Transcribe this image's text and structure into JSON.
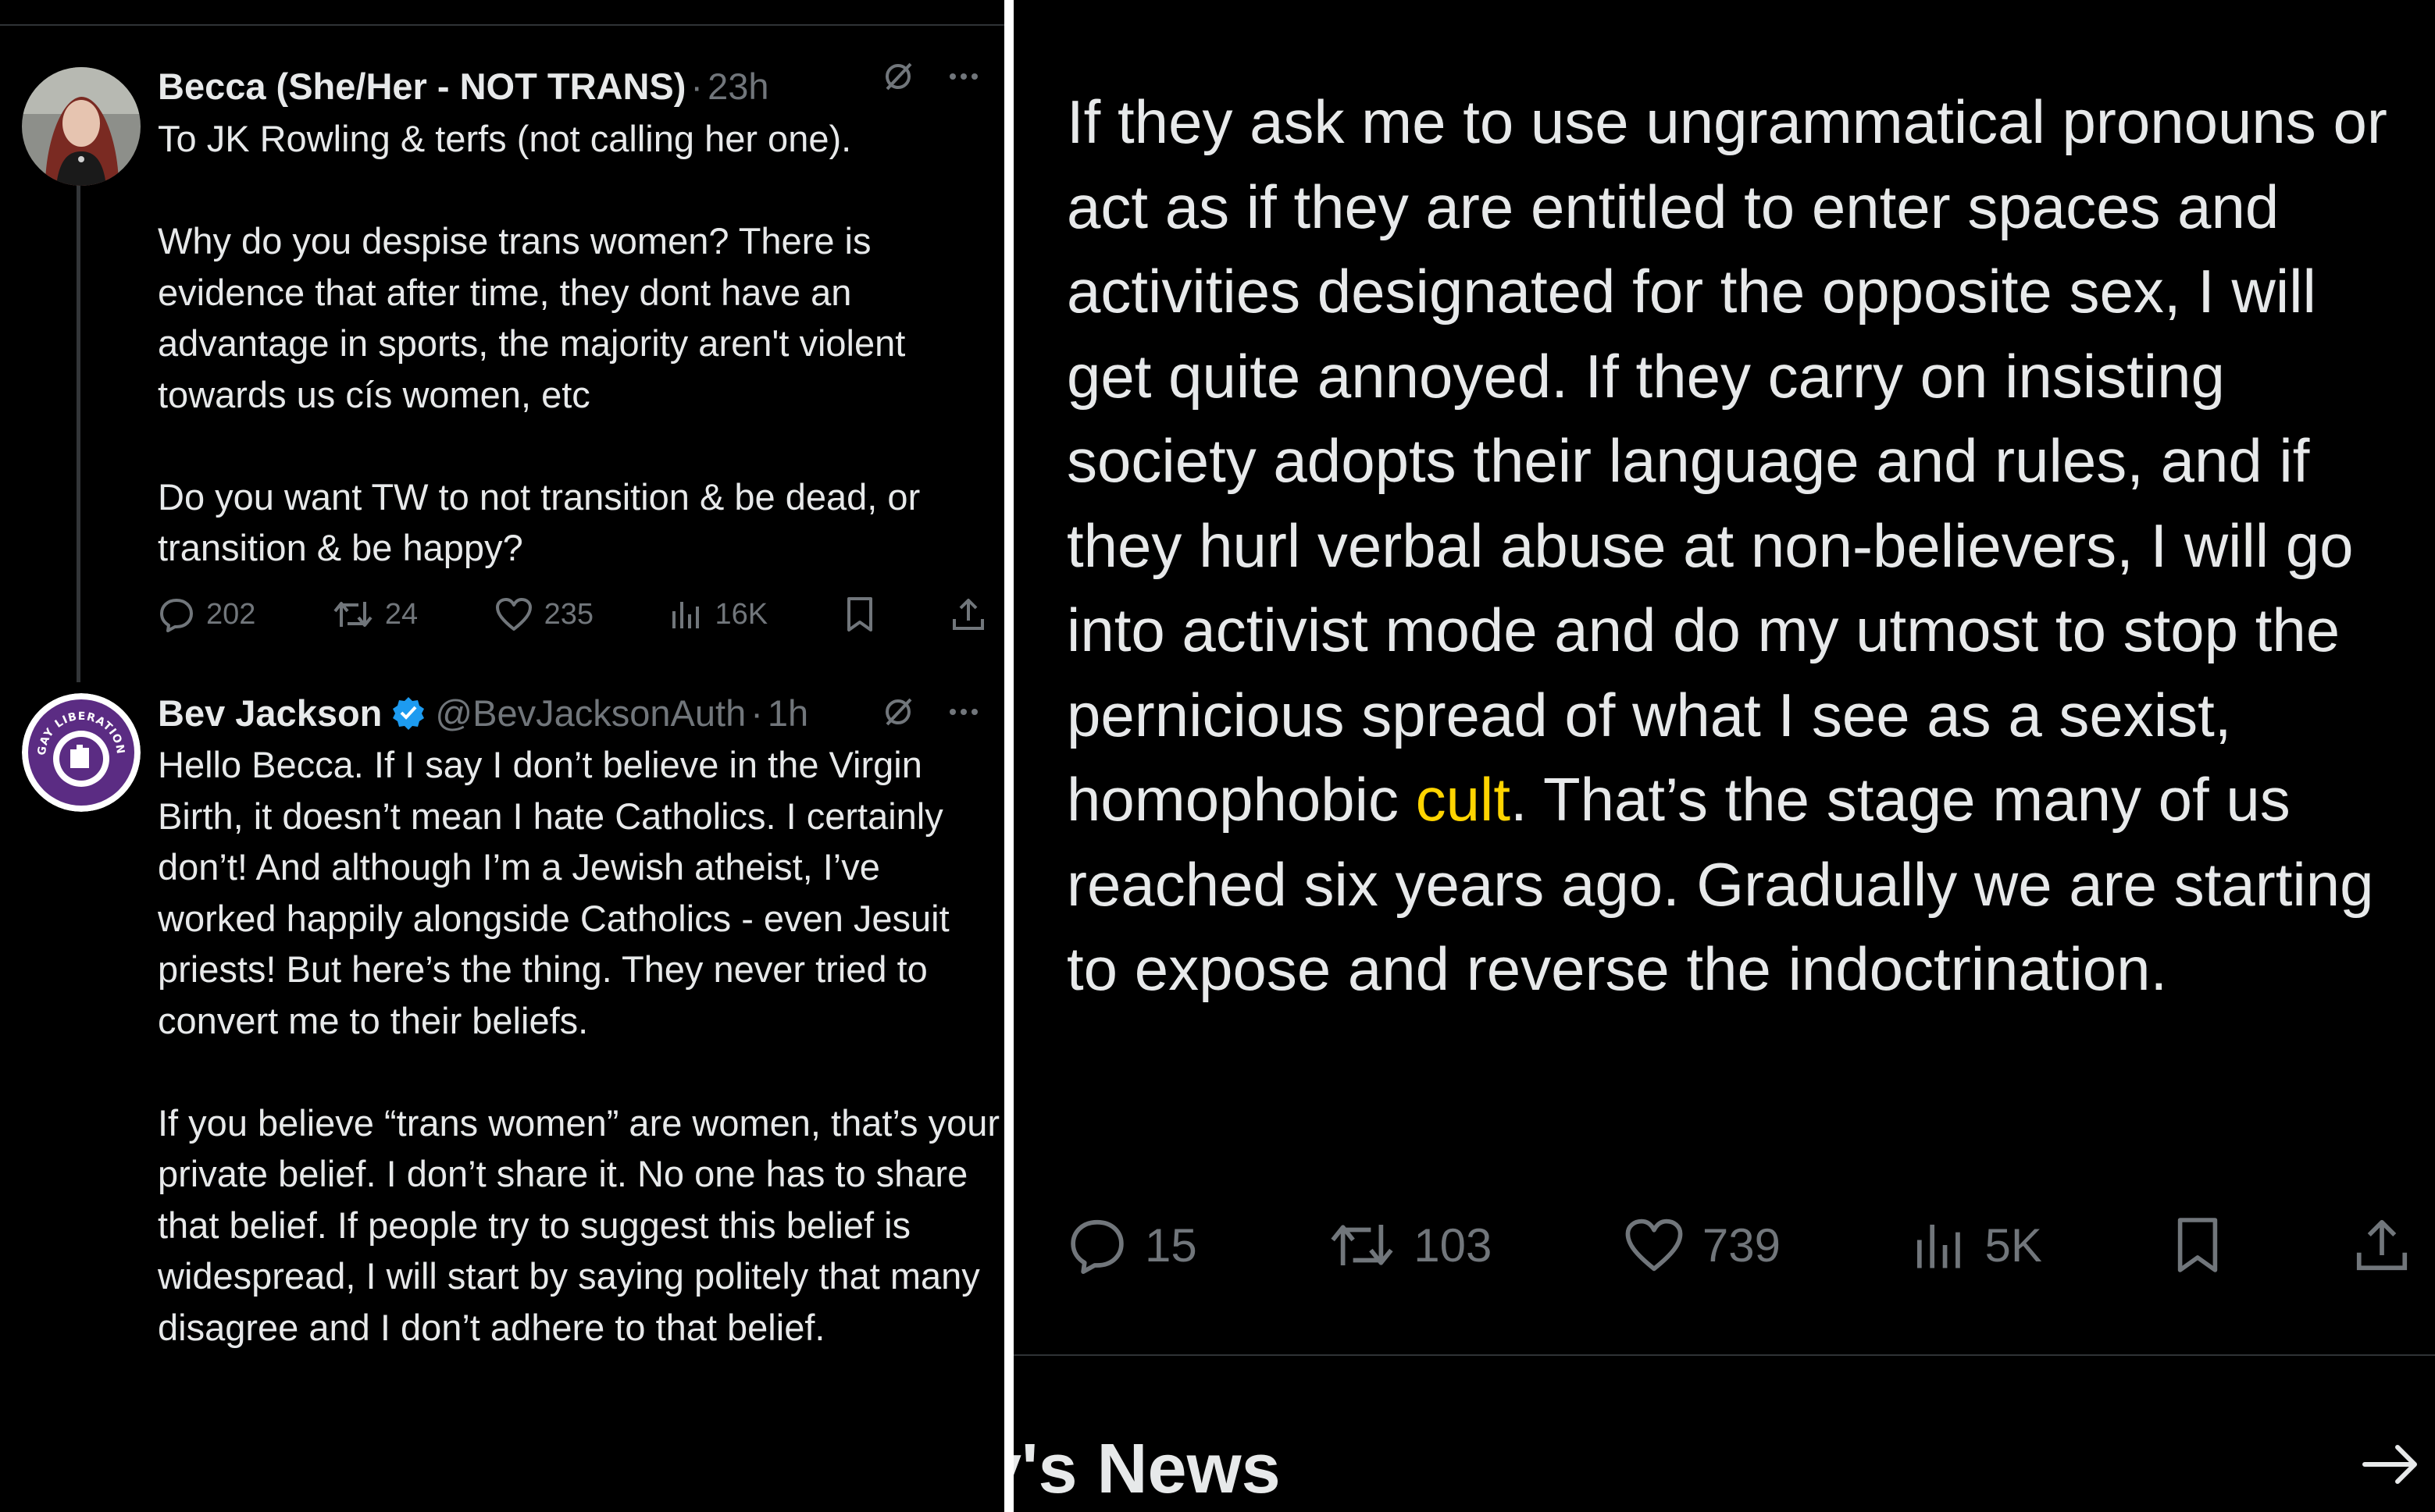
{
  "tweet1": {
    "display_name": "Becca (She/Her - NOT TRANS)",
    "time": "23h",
    "text": "To JK Rowling & terfs (not calling her one).\n\nWhy do you despise trans women? There is evidence that after time, they dont have an advantage in sports, the majority aren't violent towards us cís women, etc\n\nDo you want TW to not transition & be dead, or transition & be happy?",
    "replies": "202",
    "reposts": "24",
    "likes": "235",
    "views": "16K"
  },
  "tweet2": {
    "display_name": "Bev Jackson",
    "handle": "@BevJacksonAuth",
    "time": "1h",
    "avatar_text": "GAY LIBERATION FRONT",
    "text": "Hello Becca. If I say I don’t believe in the Virgin Birth, it doesn’t mean I hate Catholics. I certainly don’t! And although I’m a Jewish atheist, I’ve worked happily alongside Catholics - even Jesuit priests! But here’s the thing. They never tried to convert me to their beliefs.\n\nIf you believe “trans women” are women, that’s your private belief. I don’t share it. No one has to share that belief. If people try to suggest this belief is widespread, I will start by saying politely that many disagree and I don’t adhere to that belief."
  },
  "tweet3": {
    "text_before": "If they ask me to use ungrammatical pronouns or act as if they are entitled to enter spaces and activities designated for the opposite sex, I will get quite annoyed. If they carry on insisting society adopts their language and rules, and if they hurl verbal abuse at non-believers, I will go into activist mode and do my utmost to stop the pernicious spread of what I see as a sexist, homophobic ",
    "highlight": "cult",
    "text_after": ". That’s the stage many of us reached six years ago. Gradually we are starting to expose and reverse the indoctrination.",
    "replies": "15",
    "reposts": "103",
    "likes": "739",
    "views": "5K"
  },
  "news": {
    "title": "y's News"
  },
  "colors": {
    "background": "#000000",
    "text": "#e7e9ea",
    "muted": "#71767b",
    "verified": "#1d9bf0",
    "highlight": "#ffd400",
    "gay_liberation_purple": "#5b2c83"
  },
  "icons": [
    "grok-icon",
    "more-icon",
    "verified-badge-icon",
    "reply-icon",
    "repost-icon",
    "like-icon",
    "views-icon",
    "bookmark-icon",
    "share-icon",
    "arrow-right-icon"
  ]
}
